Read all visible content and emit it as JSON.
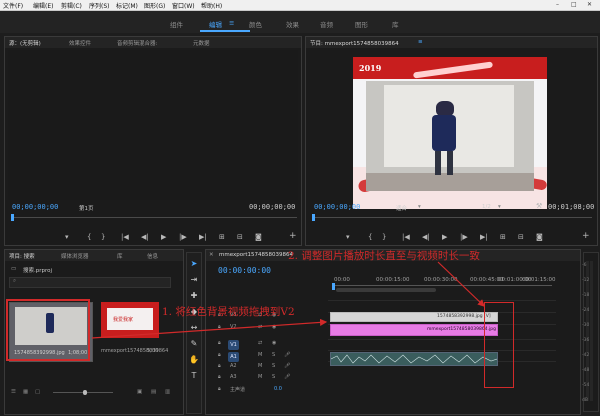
{
  "menu": [
    "文件(F)",
    "编辑(E)",
    "剪辑(C)",
    "序列(S)",
    "标记(M)",
    "图形(G)",
    "窗口(W)",
    "帮助(H)"
  ],
  "window_controls": [
    "–",
    "□",
    "✕"
  ],
  "workspaces": [
    "组件",
    "编辑",
    "颜色",
    "效果",
    "音频",
    "图形",
    "库"
  ],
  "workspace_menu_icon": "≡",
  "source_panel": {
    "tabs": [
      "源：(无剪辑)",
      "效果控件",
      "音频剪辑混合器:",
      "元数据"
    ],
    "timecode_left": "00;00;00;00",
    "page_label": "第1页",
    "timecode_right": "00;00;00;00"
  },
  "program_panel": {
    "tab": "节目: mmexport1574858039864",
    "menu_icon": "≡",
    "timecode_left": "00;00;00;00",
    "fit": "适合",
    "ratio": "1/2",
    "timecode_right": "00;01;08;00",
    "preview_logo": "2019"
  },
  "project_panel": {
    "tabs": [
      "项目: 搜索",
      "媒体浏览器",
      "库",
      "信息"
    ],
    "project_name": "搜索.prproj",
    "clips": [
      {
        "name": "1574858392998.jpg",
        "duration": "1;08;00"
      },
      {
        "name": "mmexport1574858039864",
        "duration": "5;00"
      }
    ],
    "thumb2_banner": "我爱我家"
  },
  "sequence_panel": {
    "tab": "mmexport1574858039864",
    "timecode": "00:00:00:00",
    "ruler": [
      "00:00",
      "00:00:15:00",
      "00:00:30:00",
      "00:00:45:00",
      "00:01:00:00",
      "00:01:15:00"
    ],
    "tracks": [
      "V3",
      "V2",
      "V1",
      "A1",
      "A2",
      "A3"
    ],
    "master": "主声道",
    "master_value": "0.0",
    "clip_v3": "1574858392998.jpg [V]",
    "clip_v2": "mmexport1574858039864.jpg",
    "db_scale": [
      "-6",
      "-12",
      "-18",
      "-24",
      "-30",
      "-36",
      "-42",
      "-48",
      "-54",
      "dB"
    ]
  },
  "annotations": {
    "step1": "1. 将红色背景视频拖拽到V2",
    "step2": "2. 调整图片播放时长直至与视频时长一致"
  },
  "icons": [
    "play-icon",
    "step-back-icon",
    "step-forward-icon",
    "marker-icon",
    "camera-icon",
    "plus-icon",
    "wrench-icon",
    "selection-tool-icon",
    "hand-tool-icon",
    "type-tool-icon",
    "pen-tool-icon",
    "razor-tool-icon",
    "lock-icon",
    "eye-icon",
    "mute-icon",
    "solo-icon",
    "mic-icon"
  ],
  "colors": {
    "accent": "#4aa8ff",
    "annotation": "#d22a2a",
    "v3_clip": "#d6d6d6",
    "v2_clip": "#e77be5"
  }
}
